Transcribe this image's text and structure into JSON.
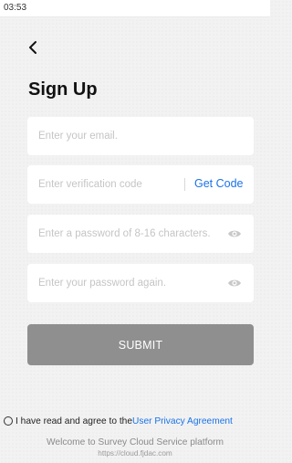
{
  "status_bar": {
    "time": "03:53"
  },
  "header": {
    "title": "Sign Up"
  },
  "form": {
    "email_placeholder": "Enter your email.",
    "code_placeholder": "Enter verification code",
    "get_code_label": "Get Code",
    "password_placeholder": "Enter a password of 8-16 characters.",
    "confirm_password_placeholder": "Enter your password again.",
    "submit_label": "SUBMIT"
  },
  "agreement": {
    "text": "I have read and agree to the",
    "link_label": "User Privacy Agreement"
  },
  "footer": {
    "welcome": "Welcome to Survey Cloud Service platform",
    "url": "https://cloud.fjdac.com"
  },
  "icons": {
    "back": "chevron-left-icon",
    "eye": "eye-icon",
    "radio": "radio-unchecked-icon"
  },
  "colors": {
    "accent": "#1a73e8",
    "submit_disabled": "#8f8f8f"
  }
}
